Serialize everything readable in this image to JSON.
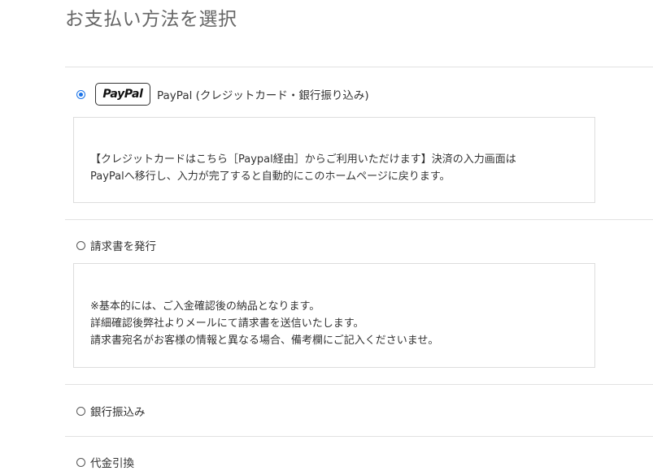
{
  "page_title": "お支払い方法を選択",
  "payment_methods": [
    {
      "logo_text": "PayPal",
      "label": "PayPal (クレジットカード・銀行振り込み)",
      "selected": true,
      "description": [
        "【クレジットカードはこちら［Paypal経由］からご利用いただけます】決済の入力画面は",
        "PayPalへ移行し、入力が完了すると自動的にこのホームページに戻ります。"
      ]
    },
    {
      "label": "請求書を発行",
      "selected": false,
      "description": [
        "※基本的には、ご入金確認後の納品となります。",
        "詳細確認後弊社よりメールにて請求書を送信いたします。",
        "請求書宛名がお客様の情報と異なる場合、備考欄にご記入くださいませ。"
      ]
    },
    {
      "label": "銀行振込み",
      "selected": false
    },
    {
      "label": "代金引換",
      "selected": false
    }
  ],
  "colors": {
    "radio_selected": "#1a73e8",
    "divider": "#e2e2e2",
    "box_border": "#dddddd",
    "title": "#666666"
  }
}
